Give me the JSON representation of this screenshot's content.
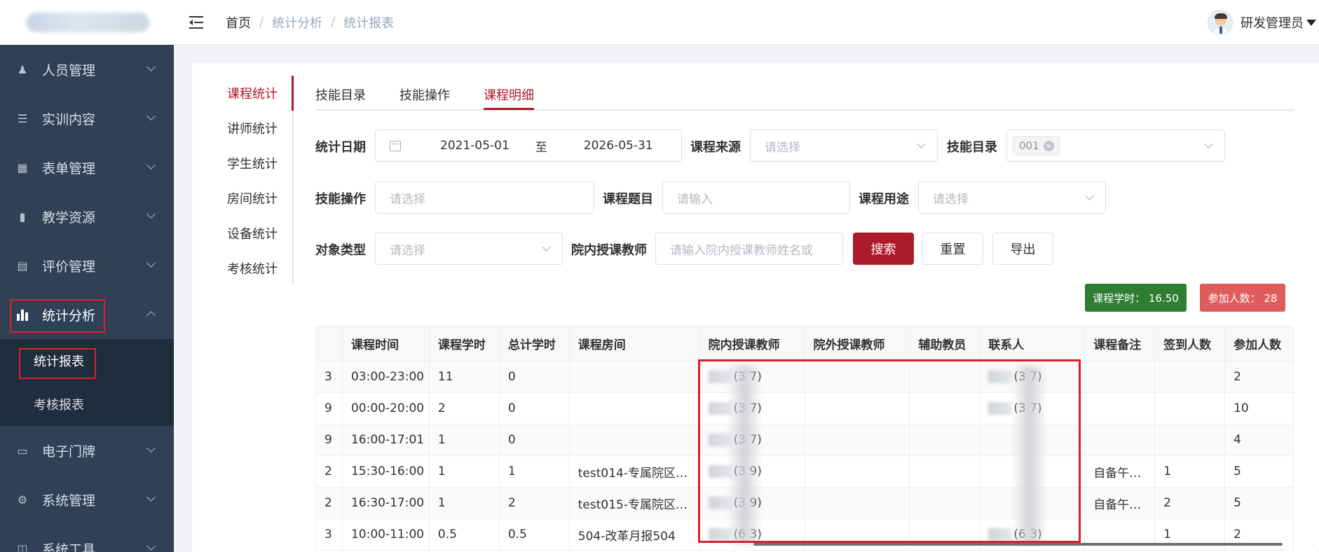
{
  "header": {
    "breadcrumb": [
      "首页",
      "统计分析",
      "统计报表"
    ],
    "user_name": "研发管理员"
  },
  "sidebar": {
    "items": [
      {
        "label": "人员管理",
        "icon": "user-icon"
      },
      {
        "label": "实训内容",
        "icon": "list-icon"
      },
      {
        "label": "表单管理",
        "icon": "form-icon"
      },
      {
        "label": "教学资源",
        "icon": "book-icon"
      },
      {
        "label": "评价管理",
        "icon": "chart-icon"
      },
      {
        "label": "统计分析",
        "icon": "bar-chart-icon"
      },
      {
        "label": "电子门牌",
        "icon": "monitor-icon"
      },
      {
        "label": "系统管理",
        "icon": "gear-icon"
      },
      {
        "label": "系统工具",
        "icon": "toolbox-icon"
      }
    ],
    "sub_items": [
      "统计报表",
      "考核报表"
    ]
  },
  "side_tabs": [
    "课程统计",
    "讲师统计",
    "学生统计",
    "房间统计",
    "设备统计",
    "考核统计"
  ],
  "top_tabs": [
    "技能目录",
    "技能操作",
    "课程明细"
  ],
  "filters": {
    "date_label": "统计日期",
    "date_start": "2021-05-01",
    "date_sep": "至",
    "date_end": "2026-05-31",
    "source_label": "课程来源",
    "source_placeholder": "请选择",
    "catalog_label": "技能目录",
    "catalog_tag": "001",
    "operation_label": "技能操作",
    "operation_placeholder": "请选择",
    "topic_label": "课程题目",
    "topic_placeholder": "请输入",
    "purpose_label": "课程用途",
    "purpose_placeholder": "请选择",
    "object_label": "对象类型",
    "object_placeholder": "请选择",
    "teacher_label": "院内授课教师",
    "teacher_placeholder": "请输入院内授课教师姓名或"
  },
  "buttons": {
    "search": "搜索",
    "reset": "重置",
    "export": "导出"
  },
  "stats": {
    "hours": "课程学时： 16.50",
    "participants": "参加人数： 28",
    "hours_color": "#2e7d32",
    "participants_color": "#e05c5c"
  },
  "table": {
    "headers": [
      "",
      "课程时间",
      "课程学时",
      "总计学时",
      "课程房间",
      "院内授课教师",
      "院外授课教师",
      "辅助教员",
      "联系人",
      "课程备注",
      "签到人数",
      "参加人数"
    ],
    "rows": [
      [
        "3",
        "03:00-23:00",
        "11",
        "0",
        "",
        "(3  7)",
        "",
        "",
        "(3  7)",
        "",
        "",
        "2"
      ],
      [
        "9",
        "00:00-20:00",
        "2",
        "0",
        "",
        "(3  7)",
        "",
        "",
        "(3  7)",
        "",
        "",
        "10"
      ],
      [
        "9",
        "16:00-17:01",
        "1",
        "0",
        "",
        "(3  7)",
        "",
        "",
        "",
        "",
        "",
        "4"
      ],
      [
        "2",
        "15:30-16:00",
        "1",
        "1",
        "test014-专属院区…",
        "(3  9)",
        "",
        "",
        "",
        "自备午…",
        "1",
        "5"
      ],
      [
        "2",
        "16:30-17:00",
        "1",
        "2",
        "test015-专属院区…",
        "(3  9)",
        "",
        "",
        "",
        "自备午…",
        "2",
        "5"
      ],
      [
        "3",
        "10:00-11:00",
        "0.5",
        "0.5",
        "504-改革月报504",
        "(6  3)",
        "",
        "",
        "(6  3)",
        "",
        "1",
        "2"
      ]
    ]
  }
}
